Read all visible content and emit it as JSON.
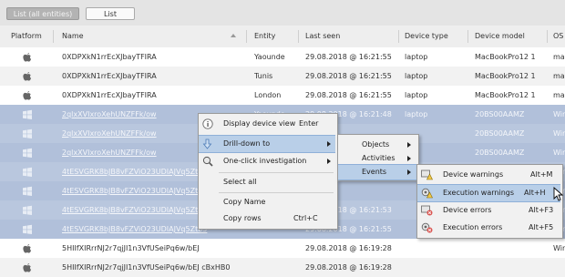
{
  "toolbar": {
    "list_all_label": "List (all entities)",
    "list_label": "List"
  },
  "columns": [
    "Platform",
    "Name",
    "Entity",
    "Last seen",
    "Device type",
    "Device model",
    "OS"
  ],
  "rows": [
    {
      "platform": "apple-icon",
      "name": "0XDPXkN1rrEcXJbayTFIRA",
      "entity": "Yaounde",
      "last_seen": "29.08.2018 @ 16:21:55",
      "device_type": "laptop",
      "device_model": "MacBookPro12 1",
      "os": "ma",
      "selected": false
    },
    {
      "platform": "apple-icon",
      "name": "0XDPXkN1rrEcXJbayTFIRA",
      "entity": "Tunis",
      "last_seen": "29.08.2018 @ 16:21:55",
      "device_type": "laptop",
      "device_model": "MacBookPro12 1",
      "os": "ma",
      "selected": false
    },
    {
      "platform": "apple-icon",
      "name": "0XDPXkN1rrEcXJbayTFIRA",
      "entity": "London",
      "last_seen": "29.08.2018 @ 16:21:55",
      "device_type": "laptop",
      "device_model": "MacBookPro12 1",
      "os": "ma",
      "selected": false
    },
    {
      "platform": "windows-icon",
      "name": "2qlxXVIxroXehUNZFFk/ow",
      "entity": "Yaounde",
      "last_seen": "29.08.2018 @ 16:21:48",
      "device_type": "laptop",
      "device_model": "20BS00AAMZ",
      "os": "Wir",
      "selected": true
    },
    {
      "platform": "windows-icon",
      "name": "2qlxXVIxroXehUNZFFk/ow",
      "entity": "",
      "last_seen": "",
      "device_type": "",
      "device_model": "20BS00AAMZ",
      "os": "Wir",
      "selected": true
    },
    {
      "platform": "windows-icon",
      "name": "2qlxXVIxroXehUNZFFk/ow",
      "entity": "",
      "last_seen": "",
      "device_type": "",
      "device_model": "20BS00AAMZ",
      "os": "Wir",
      "selected": true
    },
    {
      "platform": "windows-icon",
      "name": "4tESVGRK8bJB8vFZViO23UDIAJVq5Ztb5",
      "entity": "",
      "last_seen": "",
      "device_type": "",
      "device_model": "",
      "os": "Wir",
      "selected": true
    },
    {
      "platform": "windows-icon",
      "name": "4tESVGRK8bJB8vFZViO23UDIAJVq5Ztb5",
      "entity": "",
      "last_seen": "",
      "device_type": "",
      "device_model": "",
      "os": "Wir",
      "selected": true
    },
    {
      "platform": "windows-icon",
      "name": "4tESVGRK8bJB8vFZViO23UDIAJVq5Ztb5",
      "entity": "",
      "last_seen": "29.08.2018 @ 16:21:53",
      "device_type": "",
      "device_model": "",
      "os": "Wir",
      "selected": true
    },
    {
      "platform": "windows-icon",
      "name": "4tESVGRK8bJB8vFZViO23UDIAJVq5Ztb5",
      "entity": "",
      "last_seen": "29.08.2018 @ 16:21:55",
      "device_type": "",
      "device_model": "",
      "os": "Wir",
      "selected": true
    },
    {
      "platform": "apple-icon",
      "name": "5HIIfXIRrrNJ2r7qjJI1n3VfUSeiPq6w/bEJ",
      "entity": "",
      "last_seen": "29.08.2018 @ 16:19:28",
      "device_type": "",
      "device_model": "",
      "os": "Wir",
      "selected": false
    },
    {
      "platform": "apple-icon",
      "name": "5HIIfXIRrrNJ2r7qjJI1n3VfUSeiPq6w/bEJ cBxHB0",
      "entity": "",
      "last_seen": "29.08.2018 @ 16:19:28",
      "device_type": "",
      "device_model": "",
      "os": "",
      "selected": false
    }
  ],
  "context_menu": {
    "items": [
      {
        "label": "Display device view",
        "shortcut": "Enter",
        "icon": "info-icon"
      },
      {
        "label": "Drill-down to",
        "shortcut": "",
        "icon": "drill-icon"
      },
      {
        "label": "One-click investigation",
        "shortcut": "",
        "icon": "magnifier-icon"
      },
      {
        "label": "Select all",
        "shortcut": ""
      },
      {
        "label": "Copy Name",
        "shortcut": ""
      },
      {
        "label": "Copy rows",
        "shortcut": "Ctrl+C"
      }
    ]
  },
  "submenu_drill": {
    "items": [
      "Objects",
      "Activities",
      "Events"
    ]
  },
  "submenu_events": {
    "items": [
      {
        "label": "Device warnings",
        "shortcut": "Alt+M",
        "icon": "device-warning-icon"
      },
      {
        "label": "Execution warnings",
        "shortcut": "Alt+H",
        "icon": "execution-warning-icon"
      },
      {
        "label": "Device errors",
        "shortcut": "Alt+F3",
        "icon": "device-error-icon"
      },
      {
        "label": "Execution errors",
        "shortcut": "Alt+F5",
        "icon": "execution-error-icon"
      }
    ]
  },
  "colors": {
    "selection": "#b9c7de",
    "menu_highlight": "#b9cfe8",
    "header": "#eeeeee"
  }
}
